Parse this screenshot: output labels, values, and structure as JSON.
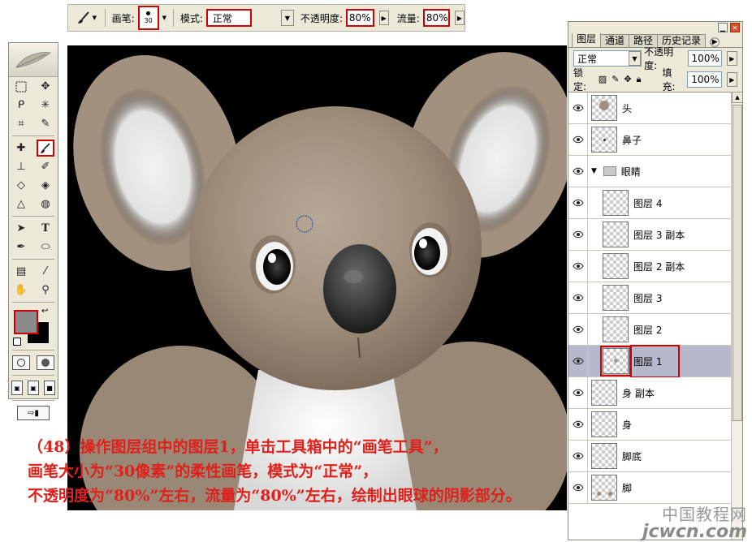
{
  "options_bar": {
    "brush_label": "画笔:",
    "brush_size": "30",
    "mode_label": "模式:",
    "mode_value": "正常",
    "opacity_label": "不透明度:",
    "opacity_value": "80%",
    "flow_label": "流量:",
    "flow_value": "80%"
  },
  "toolbox": {
    "foreground_color": "#8a8a8a",
    "background_color": "#000000",
    "active_tool": "brush-tool",
    "highlight_color": "#d00000"
  },
  "layers_panel": {
    "tabs": [
      "图层",
      "通道",
      "路径",
      "历史记录"
    ],
    "blend_mode": "正常",
    "opacity_label": "不透明度:",
    "opacity_value": "100%",
    "lock_label": "锁定:",
    "fill_label": "填充:",
    "fill_value": "100%",
    "layers": [
      {
        "name": "头",
        "indent": false,
        "group": false,
        "selected": false
      },
      {
        "name": "鼻子",
        "indent": false,
        "group": false,
        "selected": false
      },
      {
        "name": "眼睛",
        "indent": false,
        "group": true,
        "selected": false
      },
      {
        "name": "图层 4",
        "indent": true,
        "group": false,
        "selected": false
      },
      {
        "name": "图层 3 副本",
        "indent": true,
        "group": false,
        "selected": false
      },
      {
        "name": "图层 2 副本",
        "indent": true,
        "group": false,
        "selected": false
      },
      {
        "name": "图层 3",
        "indent": true,
        "group": false,
        "selected": false
      },
      {
        "name": "图层 2",
        "indent": true,
        "group": false,
        "selected": false
      },
      {
        "name": "图层 1",
        "indent": true,
        "group": false,
        "selected": true
      },
      {
        "name": "身 副本",
        "indent": false,
        "group": false,
        "selected": false
      },
      {
        "name": "身",
        "indent": false,
        "group": false,
        "selected": false
      },
      {
        "name": "脚底",
        "indent": false,
        "group": false,
        "selected": false
      },
      {
        "name": "脚",
        "indent": false,
        "group": false,
        "selected": false
      }
    ]
  },
  "caption": {
    "line1": "（48）操作图层组中的图层1，单击工具箱中的“画笔工具”，",
    "line2": "画笔大小为“30像素”的柔性画笔，模式为“正常”，",
    "line3": "不透明度为“80%”左右，流量为“80%”左右，绘制出眼球的阴影部分。"
  },
  "watermark": {
    "cn": "中国教程网",
    "en": "jcwcn.com"
  }
}
